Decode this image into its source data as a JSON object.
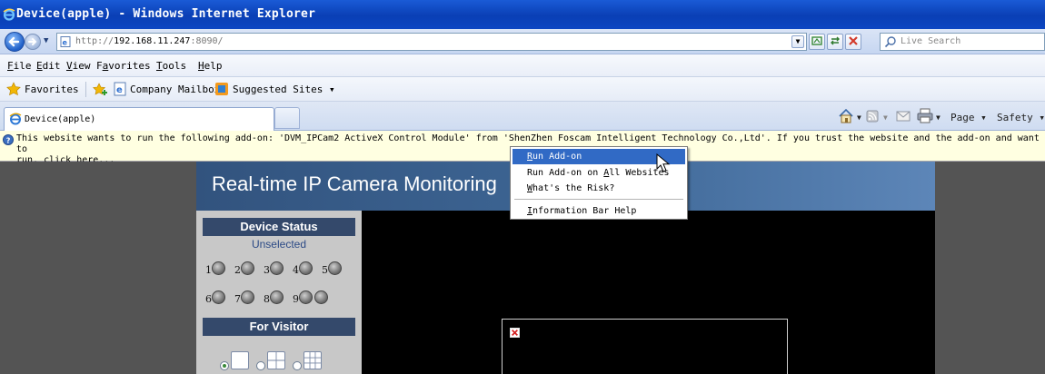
{
  "window": {
    "title": "Device(apple) - Windows Internet Explorer"
  },
  "address_bar": {
    "url_prefix": "http://",
    "url_host": "192.168.11.247",
    "url_suffix": ":8090/",
    "search_placeholder": "Live Search"
  },
  "menu": {
    "items": [
      {
        "underline": "F",
        "rest": "ile"
      },
      {
        "underline": "E",
        "rest": "dit"
      },
      {
        "underline": "V",
        "rest": "iew"
      },
      {
        "prefix": "F",
        "underline": "a",
        "rest": "vorites"
      },
      {
        "underline": "T",
        "rest": "ools"
      },
      {
        "underline": "H",
        "rest": "elp"
      }
    ]
  },
  "favorites_bar": {
    "favorites_label": "Favorites",
    "company_mailbox": "Company Mailbox",
    "suggested_sites": "Suggested Sites ▾"
  },
  "tabs": {
    "active_label": "Device(apple)"
  },
  "command_bar": {
    "page_label": "Page ▾",
    "safety_label": "Safety ▾"
  },
  "info_bar": {
    "message_line1": "This website wants to run the following add-on: 'DVM_IPCam2 ActiveX Control Module' from 'ShenZhen Foscam Intelligent Technology Co.,Ltd'. If you trust the website and the add-on and want to",
    "message_line2": "run, click here..."
  },
  "context_menu": {
    "items": [
      {
        "underline": "R",
        "rest": "un Add-on"
      },
      {
        "pre": "Run Add-on on ",
        "underline": "A",
        "rest": "ll Websites"
      },
      {
        "underline": "W",
        "rest": "hat's the Risk?"
      },
      {
        "underline": "I",
        "rest": "nformation Bar Help"
      }
    ]
  },
  "page": {
    "banner_title": "Real-time IP Camera Monitoring",
    "device_status_heading": "Device Status",
    "device_status_value": "Unselected",
    "cameras_row1": [
      "1",
      "2",
      "3",
      "4",
      "5"
    ],
    "cameras_row2": [
      "6",
      "7",
      "8",
      "9",
      ""
    ],
    "for_visitor_heading": "For Visitor"
  },
  "colors": {
    "title_bar": "#0a3fb5",
    "info_bar": "#ffffe1",
    "menu_highlight": "#316ac5",
    "banner": "#3e6796",
    "side_heading": "#34496b",
    "video_bg": "#000000"
  }
}
